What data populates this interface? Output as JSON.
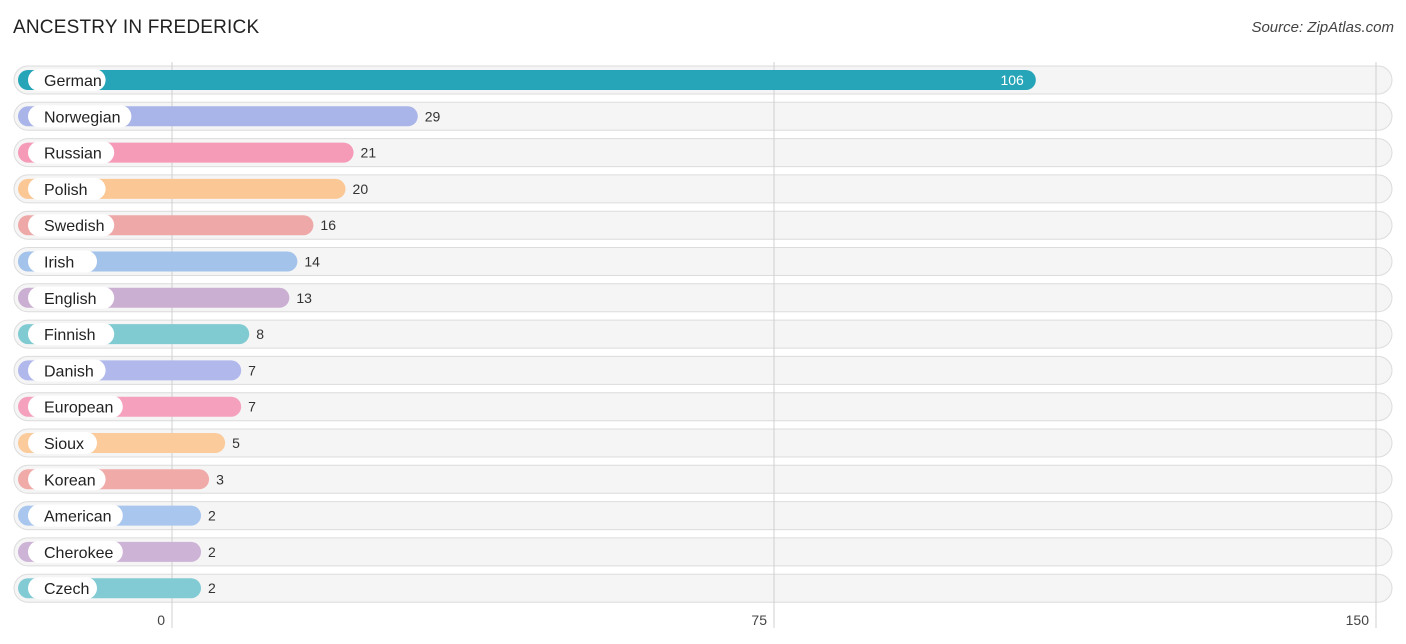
{
  "header": {
    "title": "ANCESTRY IN FREDERICK",
    "source": "Source: ZipAtlas.com"
  },
  "chart_data": {
    "type": "bar",
    "orientation": "horizontal",
    "title": "ANCESTRY IN FREDERICK",
    "xlabel": "",
    "ylabel": "",
    "xlim": [
      0,
      150
    ],
    "xticks": [
      0,
      75,
      150
    ],
    "grid": true,
    "legend": "none",
    "categories": [
      "German",
      "Norwegian",
      "Russian",
      "Polish",
      "Swedish",
      "Irish",
      "English",
      "Finnish",
      "Danish",
      "European",
      "Sioux",
      "Korean",
      "American",
      "Cherokee",
      "Czech"
    ],
    "values": [
      106,
      29,
      21,
      20,
      16,
      14,
      13,
      8,
      7,
      7,
      5,
      3,
      2,
      2,
      2
    ],
    "colors": [
      "#26a5b8",
      "#a9b4e8",
      "#f59bb8",
      "#fbc895",
      "#eea8a8",
      "#a3c3ea",
      "#cbafd2",
      "#7fcbd1",
      "#b1b8ec",
      "#f5a1bd",
      "#fbcb9c",
      "#f0aaa8",
      "#a9c6ee",
      "#cdb3d6",
      "#82cbd4"
    ]
  }
}
